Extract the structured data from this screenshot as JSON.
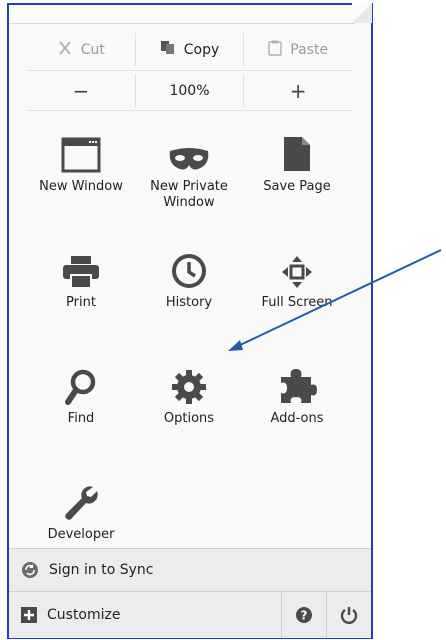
{
  "edit": {
    "cut_label": "Cut",
    "copy_label": "Copy",
    "paste_label": "Paste"
  },
  "zoom": {
    "minus": "−",
    "level": "100%",
    "plus": "+"
  },
  "tiles": [
    {
      "label": "New Window",
      "icon": "window-icon"
    },
    {
      "label": "New Private Window",
      "icon": "mask-icon"
    },
    {
      "label": "Save Page",
      "icon": "document-icon"
    },
    {
      "label": "Print",
      "icon": "printer-icon"
    },
    {
      "label": "History",
      "icon": "clock-icon"
    },
    {
      "label": "Full Screen",
      "icon": "fullscreen-arrows-icon"
    },
    {
      "label": "Find",
      "icon": "magnifier-icon"
    },
    {
      "label": "Options",
      "icon": "gear-icon"
    },
    {
      "label": "Add-ons",
      "icon": "puzzle-piece-icon"
    },
    {
      "label": "Developer",
      "icon": "wrench-icon"
    }
  ],
  "footer": {
    "sync_label": "Sign in to Sync",
    "customize_label": "Customize"
  },
  "colors": {
    "panel_border": "#1f3fbf",
    "annotation_arrow": "#1f5fa8",
    "icon_dark": "#4a4a4a"
  }
}
